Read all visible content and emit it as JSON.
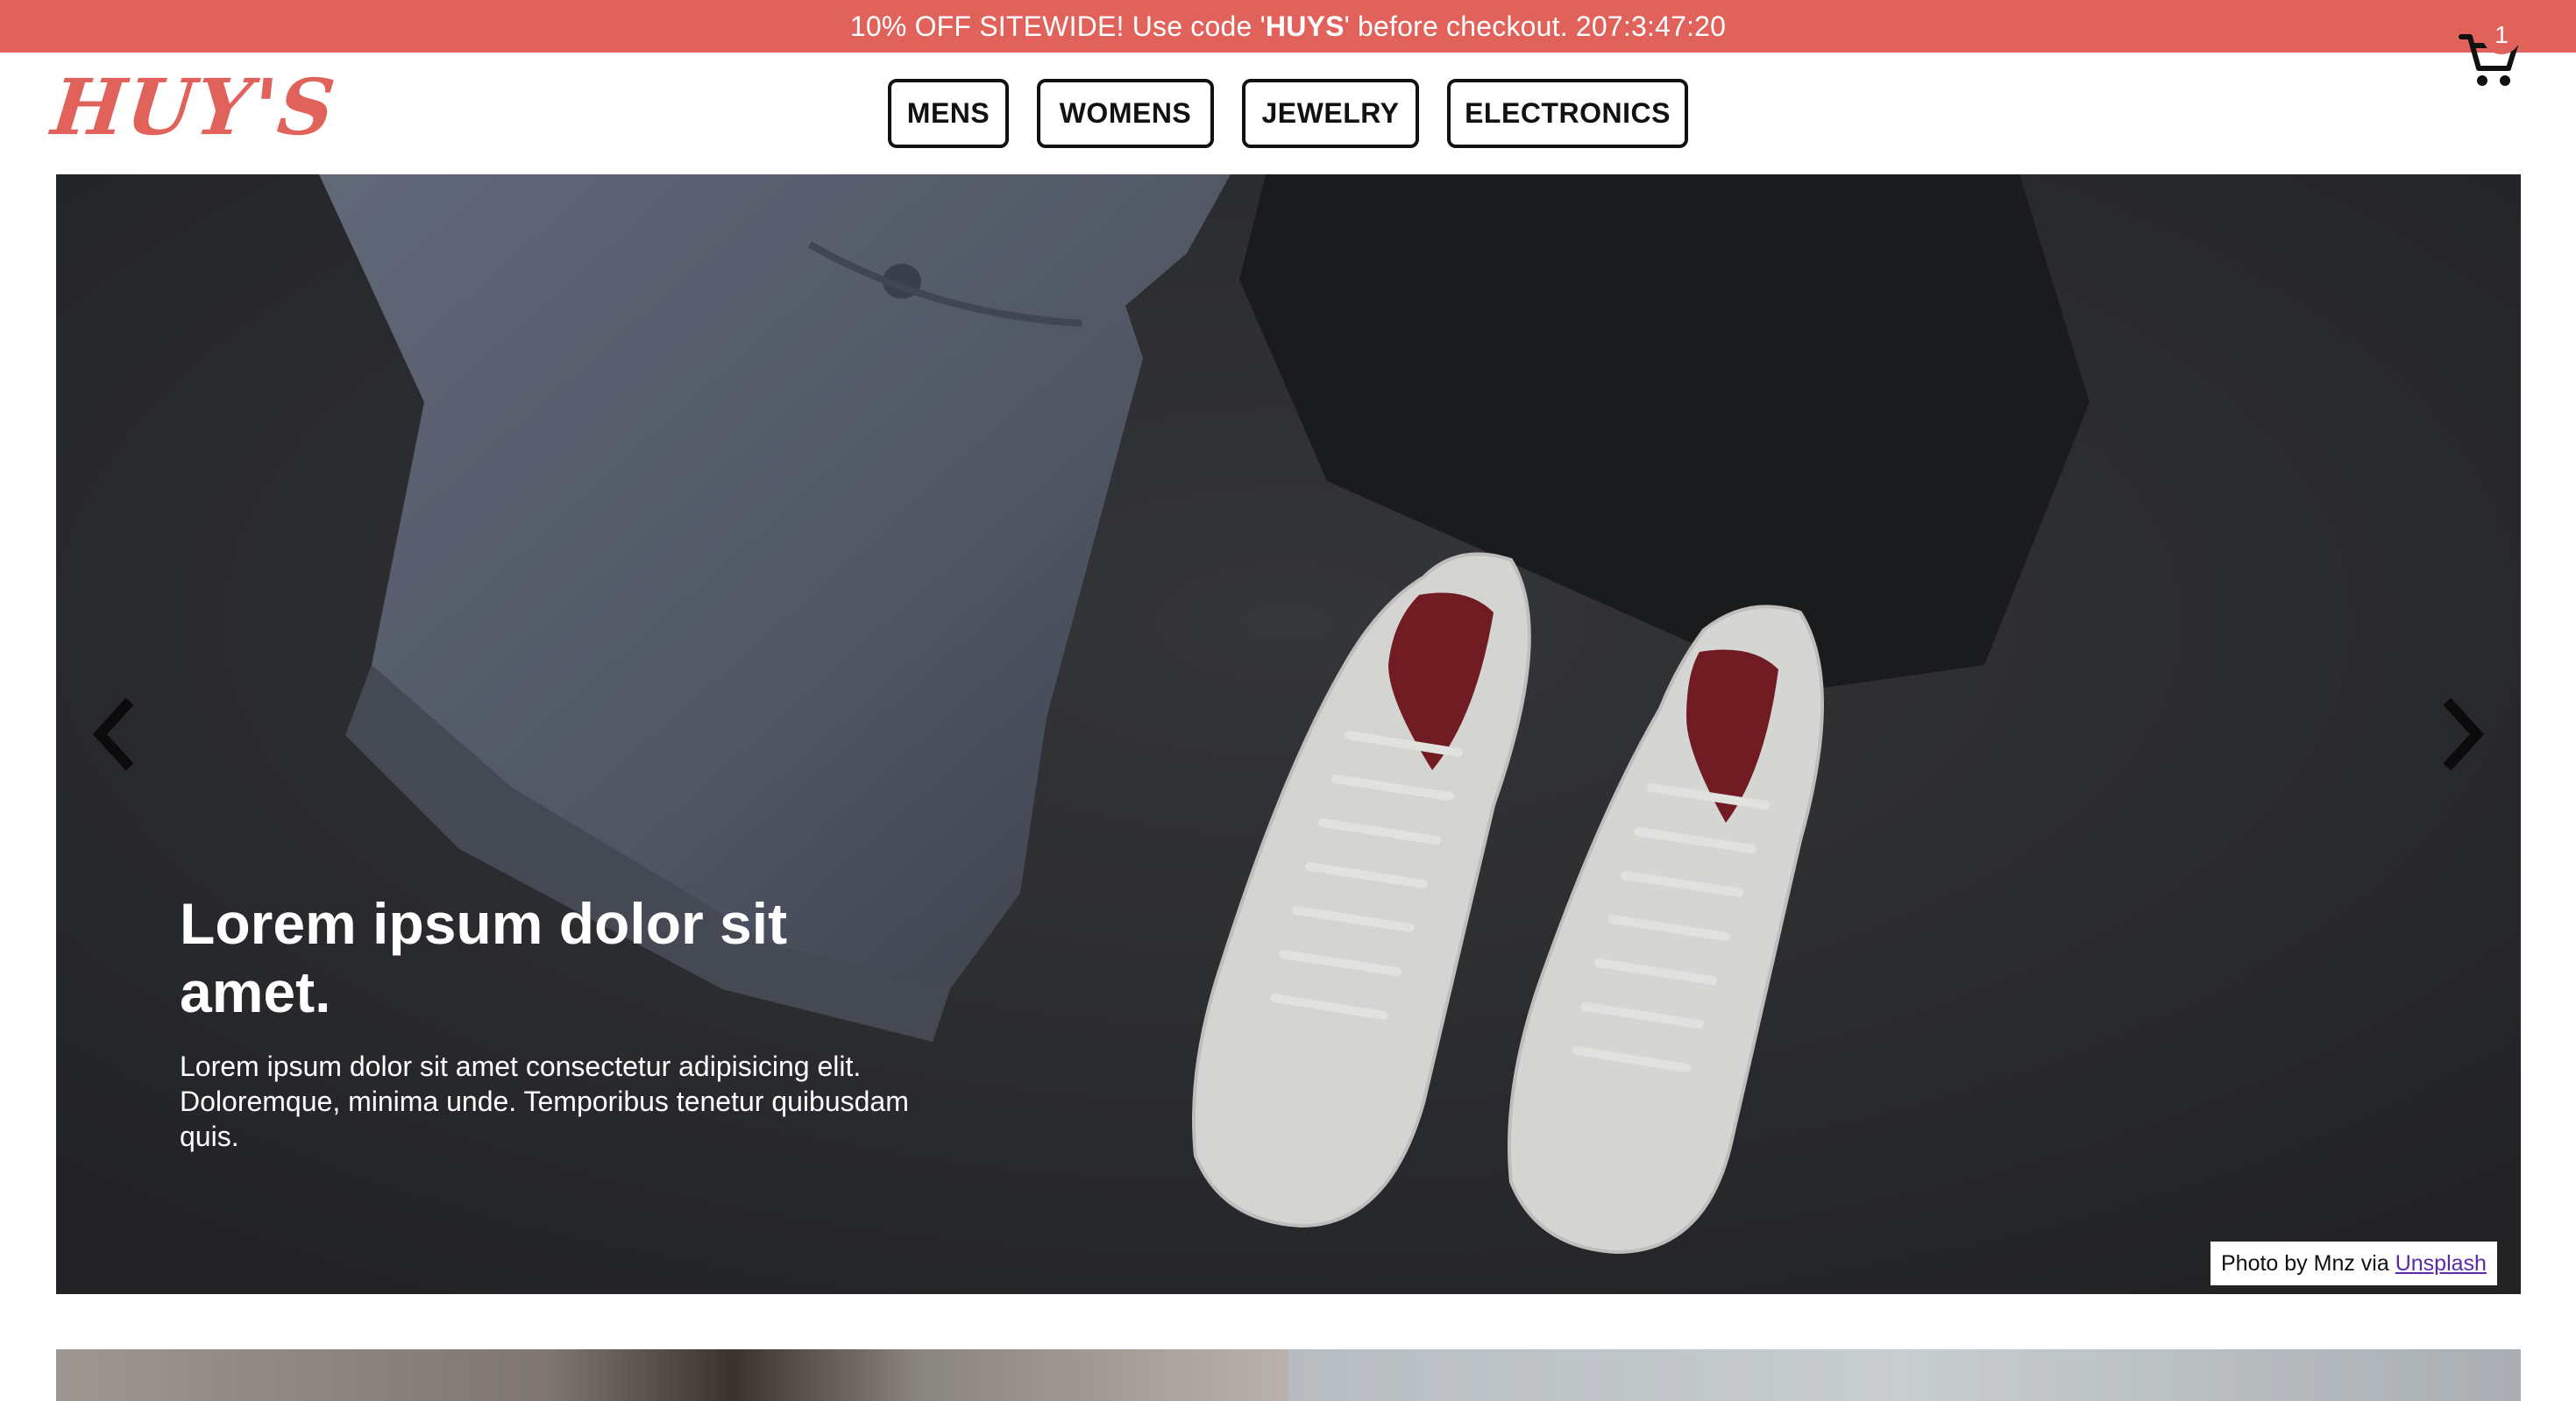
{
  "promo": {
    "prefix": "10% OFF SITEWIDE! Use code '",
    "code": "HUYS",
    "suffix": "' before checkout. 207:3:47:20"
  },
  "header": {
    "logo": "HUY'S",
    "nav": [
      "MENS",
      "WOMENS",
      "JEWELRY",
      "ELECTRONICS"
    ],
    "cart_count": "1"
  },
  "hero": {
    "title": "Lorem ipsum dolor sit amet.",
    "body": "Lorem ipsum dolor sit amet consectetur adipisicing elit. Doloremque, minima unde. Temporibus tenetur quibusdam quis.",
    "credit_prefix": "Photo by Mnz via ",
    "credit_link": "Unsplash"
  },
  "icons": {
    "cart": "cart-icon",
    "prev": "chevron-left-icon",
    "next": "chevron-right-icon"
  },
  "colors": {
    "accent": "#e0625a",
    "hero_bg": "#2f3033",
    "link": "#5a2aa8"
  }
}
